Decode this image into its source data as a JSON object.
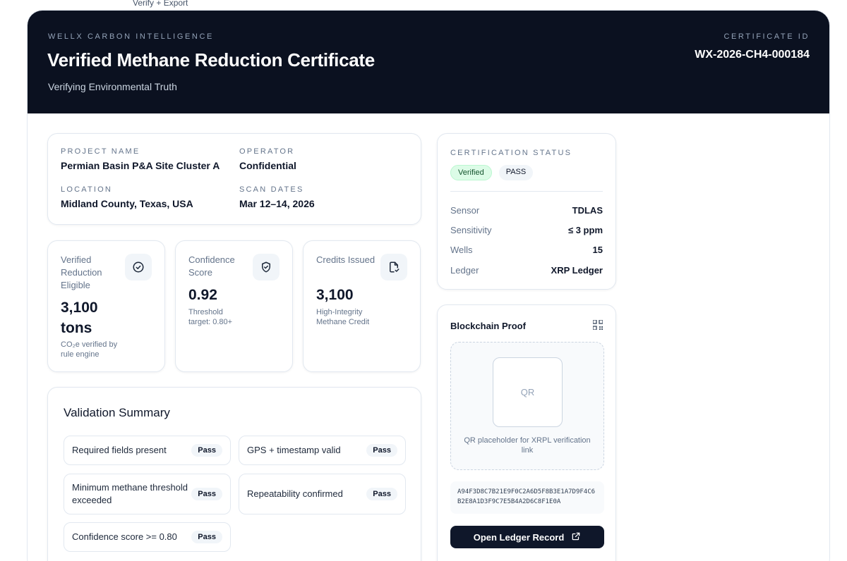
{
  "top_tab": "Verify + Export",
  "header": {
    "eyebrow": "WELLX CARBON INTELLIGENCE",
    "title": "Verified Methane Reduction Certificate",
    "tagline": "Verifying Environmental Truth",
    "cert_label": "CERTIFICATE ID",
    "cert_id": "WX-2026-CH4-000184"
  },
  "project": {
    "name_label": "PROJECT NAME",
    "name": "Permian Basin P&A Site Cluster A",
    "operator_label": "OPERATOR",
    "operator": "Confidential",
    "location_label": "LOCATION",
    "location": "Midland County, Texas, USA",
    "dates_label": "SCAN DATES",
    "dates": "Mar 12–14, 2026"
  },
  "metrics": [
    {
      "label": "Verified Reduction Eligible",
      "value": "3,100 tons",
      "sub": "CO₂e verified by rule engine",
      "icon": "check-circle-icon"
    },
    {
      "label": "Confidence Score",
      "value": "0.92",
      "sub": "Threshold target: 0.80+",
      "icon": "shield-check-icon"
    },
    {
      "label": "Credits Issued",
      "value": "3,100",
      "sub": "High-Integrity Methane Credit",
      "icon": "document-check-icon"
    }
  ],
  "validation": {
    "title": "Validation Summary",
    "checks": [
      {
        "text": "Required fields present",
        "status": "Pass"
      },
      {
        "text": "GPS + timestamp valid",
        "status": "Pass"
      },
      {
        "text": "Minimum methane threshold exceeded",
        "status": "Pass"
      },
      {
        "text": "Repeatability confirmed",
        "status": "Pass"
      },
      {
        "text": "Confidence score >= 0.80",
        "status": "Pass"
      }
    ]
  },
  "status": {
    "label": "CERTIFICATION STATUS",
    "badge_verified": "Verified",
    "badge_pass": "PASS",
    "rows": [
      {
        "key": "Sensor",
        "value": "TDLAS"
      },
      {
        "key": "Sensitivity",
        "value": "≤ 3 ppm"
      },
      {
        "key": "Wells",
        "value": "15"
      },
      {
        "key": "Ledger",
        "value": "XRP Ledger"
      }
    ]
  },
  "blockchain": {
    "title": "Blockchain Proof",
    "qr_text": "QR",
    "qr_caption": "QR placeholder for XRPL verification link",
    "hash": "A94F3D8C7B21E9F0C2A6D5F8B3E1A7D9F4C6B2E8A1D3F9C7E5B4A2D6C8F1E0A",
    "button_label": "Open Ledger Record"
  },
  "colors": {
    "header_bg": "#0b1120",
    "verified_bg": "#dcfce7",
    "button_bg": "#0f172a"
  }
}
